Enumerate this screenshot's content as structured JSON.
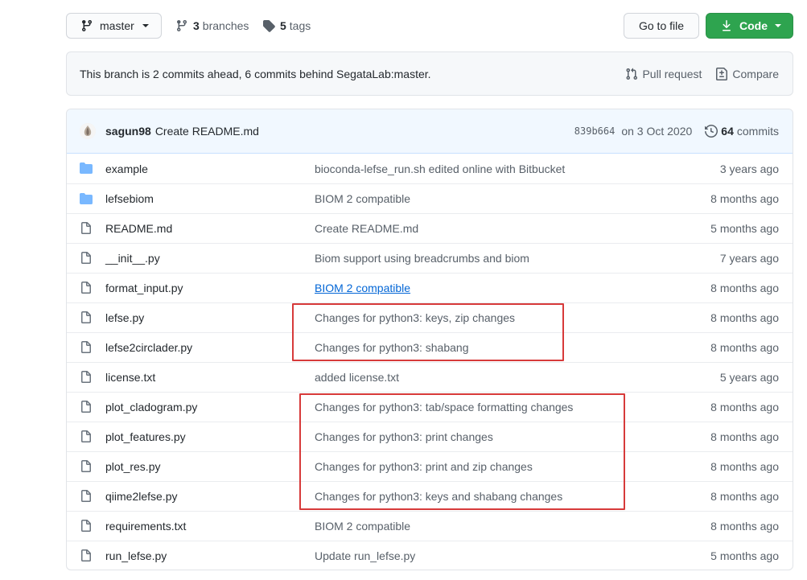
{
  "toolbar": {
    "branch_label": "master",
    "branches_count": "3",
    "branches_label": "branches",
    "tags_count": "5",
    "tags_label": "tags",
    "goto_label": "Go to file",
    "code_label": "Code"
  },
  "branch_info": {
    "message": "This branch is 2 commits ahead, 6 commits behind SegataLab:master.",
    "pull_request_label": "Pull request",
    "compare_label": "Compare"
  },
  "latest_commit": {
    "author": "sagun98",
    "message": "Create README.md",
    "sha": "839b664",
    "date": "on 3 Oct 2020",
    "commits_count": "64",
    "commits_label": "commits"
  },
  "files": [
    {
      "type": "folder",
      "name": "example",
      "message": "bioconda-lefse_run.sh edited online with Bitbucket",
      "age": "3 years ago"
    },
    {
      "type": "folder",
      "name": "lefsebiom",
      "message": "BIOM 2 compatible",
      "age": "8 months ago"
    },
    {
      "type": "file",
      "name": "README.md",
      "message": "Create README.md",
      "age": "5 months ago"
    },
    {
      "type": "file",
      "name": "__init__.py",
      "message": "Biom support using breadcrumbs and biom",
      "age": "7 years ago"
    },
    {
      "type": "file",
      "name": "format_input.py",
      "message": "BIOM 2 compatible",
      "age": "8 months ago"
    },
    {
      "type": "file",
      "name": "lefse.py",
      "message": "Changes for python3: keys, zip changes",
      "age": "8 months ago"
    },
    {
      "type": "file",
      "name": "lefse2circlader.py",
      "message": "Changes for python3: shabang",
      "age": "8 months ago"
    },
    {
      "type": "file",
      "name": "license.txt",
      "message": "added license.txt",
      "age": "5 years ago"
    },
    {
      "type": "file",
      "name": "plot_cladogram.py",
      "message": "Changes for python3: tab/space formatting changes",
      "age": "8 months ago"
    },
    {
      "type": "file",
      "name": "plot_features.py",
      "message": "Changes for python3: print changes",
      "age": "8 months ago"
    },
    {
      "type": "file",
      "name": "plot_res.py",
      "message": "Changes for python3: print and zip changes",
      "age": "8 months ago"
    },
    {
      "type": "file",
      "name": "qiime2lefse.py",
      "message": "Changes for python3: keys and shabang changes",
      "age": "8 months ago"
    },
    {
      "type": "file",
      "name": "requirements.txt",
      "message": "BIOM 2 compatible",
      "age": "8 months ago"
    },
    {
      "type": "file",
      "name": "run_lefse.py",
      "message": "Update run_lefse.py",
      "age": "5 months ago"
    }
  ],
  "colors": {
    "accent_green": "#2ea44f",
    "link_blue": "#0366d6",
    "folder_blue": "#79b8ff",
    "highlight_red": "#d73a3a"
  }
}
